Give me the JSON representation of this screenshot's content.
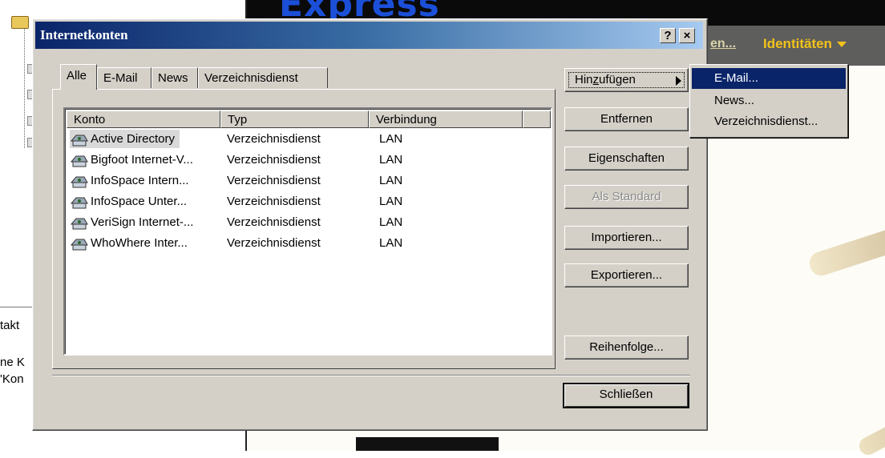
{
  "background": {
    "left_pane": {
      "contacts_label": "takt",
      "line1": "ne K",
      "line2": "'Kon"
    },
    "banner": {
      "brand_text": "Express",
      "menu_link": "en...",
      "identities_label": "Identitäten"
    }
  },
  "dialog": {
    "title": "Internetkonten",
    "help_button": "?",
    "close_button": "×",
    "tabs": [
      {
        "label": "Alle"
      },
      {
        "label": "E-Mail"
      },
      {
        "label": "News"
      },
      {
        "label": "Verzeichnisdienst"
      }
    ],
    "list": {
      "columns": [
        "Konto",
        "Typ",
        "Verbindung"
      ],
      "rows": [
        {
          "account": "Active Directory",
          "type": "Verzeichnisdienst",
          "connection": "LAN"
        },
        {
          "account": "Bigfoot Internet-V...",
          "type": "Verzeichnisdienst",
          "connection": "LAN"
        },
        {
          "account": "InfoSpace Intern...",
          "type": "Verzeichnisdienst",
          "connection": "LAN"
        },
        {
          "account": "InfoSpace Unter...",
          "type": "Verzeichnisdienst",
          "connection": "LAN"
        },
        {
          "account": "VeriSign Internet-...",
          "type": "Verzeichnisdienst",
          "connection": "LAN"
        },
        {
          "account": "WhoWhere Inter...",
          "type": "Verzeichnisdienst",
          "connection": "LAN"
        }
      ]
    },
    "buttons": {
      "add_prefix": "Hin",
      "add_underline": "z",
      "add_suffix": "ufügen",
      "remove": "Entfernen",
      "properties": "Eigenschaften",
      "set_default": "Als Standard",
      "import": "Importieren...",
      "export": "Exportieren...",
      "order": "Reihenfolge...",
      "close": "Schließen"
    }
  },
  "popup_menu": {
    "items": [
      "E-Mail...",
      "News...",
      "Verzeichnisdienst..."
    ]
  },
  "colors": {
    "titlebar_start": "#0a246a",
    "titlebar_end": "#a6caf0",
    "dialog_face": "#d4d0c8",
    "menu_highlight": "#0a246a",
    "identities": "#f2c21a",
    "brand": "#1b4fd8"
  }
}
